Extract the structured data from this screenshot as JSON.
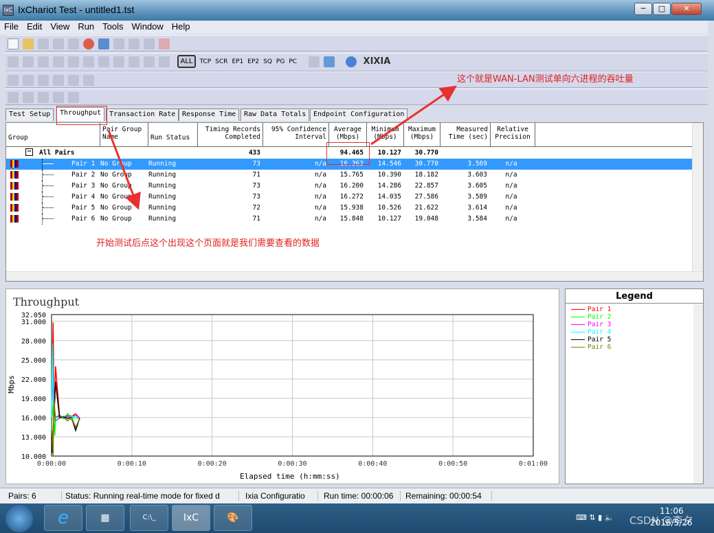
{
  "window": {
    "title": "IxChariot Test - untitled1.tst",
    "app_icon": "IxC",
    "min": "─",
    "max": "□",
    "close": "✕"
  },
  "menu": [
    "File",
    "Edit",
    "View",
    "Run",
    "Tools",
    "Window",
    "Help"
  ],
  "protocol_filters": [
    "ALL",
    "TCP",
    "SCR",
    "EP1",
    "EP2",
    "SQ",
    "PG",
    "PC"
  ],
  "brand": "XIXIA",
  "tabs": [
    "Test Setup",
    "Throughput",
    "Transaction Rate",
    "Response Time",
    "Raw Data Totals",
    "Endpoint Configuration"
  ],
  "active_tab": "Throughput",
  "table": {
    "headers": [
      "Group",
      "Pair Group\nName",
      "Run Status",
      "Timing Records\nCompleted",
      "95% Confidence\nInterval",
      "Average\n(Mbps)",
      "Minimum\n(Mbps)",
      "Maximum\n(Mbps)",
      "Measured\nTime (sec)",
      "Relative\nPrecision"
    ],
    "summary": {
      "label": "All Pairs",
      "records": "433",
      "average": "94.465",
      "minimum": "10.127",
      "maximum": "30.770"
    },
    "rows": [
      {
        "pair": "Pair 1",
        "group": "No Group",
        "status": "Running",
        "records": "73",
        "ci": "n/a",
        "avg": "16.363",
        "min": "14.546",
        "max": "30.770",
        "time": "3.569",
        "prec": "n/a"
      },
      {
        "pair": "Pair 2",
        "group": "No Group",
        "status": "Running",
        "records": "71",
        "ci": "n/a",
        "avg": "15.765",
        "min": "10.390",
        "max": "18.182",
        "time": "3.603",
        "prec": "n/a"
      },
      {
        "pair": "Pair 3",
        "group": "No Group",
        "status": "Running",
        "records": "73",
        "ci": "n/a",
        "avg": "16.200",
        "min": "14.286",
        "max": "22.857",
        "time": "3.605",
        "prec": "n/a"
      },
      {
        "pair": "Pair 4",
        "group": "No Group",
        "status": "Running",
        "records": "73",
        "ci": "n/a",
        "avg": "16.272",
        "min": "14.035",
        "max": "27.586",
        "time": "3.589",
        "prec": "n/a"
      },
      {
        "pair": "Pair 5",
        "group": "No Group",
        "status": "Running",
        "records": "72",
        "ci": "n/a",
        "avg": "15.938",
        "min": "10.526",
        "max": "21.622",
        "time": "3.614",
        "prec": "n/a"
      },
      {
        "pair": "Pair 6",
        "group": "No Group",
        "status": "Running",
        "records": "71",
        "ci": "n/a",
        "avg": "15.848",
        "min": "10.127",
        "max": "19.048",
        "time": "3.584",
        "prec": "n/a"
      }
    ]
  },
  "chart_data": {
    "type": "line",
    "title": "Throughput",
    "xlabel": "Elapsed time (h:mm:ss)",
    "ylabel": "Mbps",
    "ylim": [
      10,
      32.05
    ],
    "xlim": [
      0,
      60
    ],
    "yticks": [
      "32.050",
      "31.000",
      "28.000",
      "25.000",
      "22.000",
      "19.000",
      "16.000",
      "13.000",
      "10.000"
    ],
    "xticks": [
      "0:00:00",
      "0:00:10",
      "0:00:20",
      "0:00:30",
      "0:00:40",
      "0:00:50",
      "0:01:00"
    ],
    "grid": true,
    "legend": "right",
    "series": [
      {
        "name": "Pair 1",
        "color": "#ff0000",
        "x": [
          0,
          0.2,
          0.3,
          0.5,
          1,
          1.5,
          2,
          2.5,
          3,
          3.5
        ],
        "y": [
          16,
          30.8,
          16,
          24,
          16.2,
          16.1,
          16.4,
          16.2,
          16.6,
          15.9
        ]
      },
      {
        "name": "Pair 2",
        "color": "#00ff00",
        "x": [
          0,
          0.2,
          0.4,
          0.5,
          1,
          1.5,
          2,
          2.5,
          3,
          3.5
        ],
        "y": [
          15,
          18,
          13.2,
          16,
          16.4,
          15.8,
          16.6,
          15.6,
          16.5,
          15.5
        ]
      },
      {
        "name": "Pair 3",
        "color": "#ff00ff",
        "x": [
          0,
          0.2,
          0.3,
          0.5,
          1,
          1.5,
          2,
          2.5,
          3,
          3.5
        ],
        "y": [
          17,
          22.8,
          18,
          16,
          16.3,
          16,
          16.2,
          16.1,
          16.4,
          16
        ]
      },
      {
        "name": "Pair 4",
        "color": "#00ffff",
        "x": [
          0,
          0.1,
          0.3,
          0.5,
          1,
          1.5,
          2,
          2.5,
          3,
          3.5
        ],
        "y": [
          14,
          27.5,
          15,
          16,
          16,
          16.2,
          15.8,
          16.3,
          16,
          15.8
        ]
      },
      {
        "name": "Pair 5",
        "color": "#000000",
        "x": [
          0,
          0.1,
          0.3,
          0.5,
          1,
          1.5,
          2,
          2.5,
          3,
          3.5
        ],
        "y": [
          13,
          10.5,
          16,
          21.6,
          16,
          16.1,
          15.9,
          16,
          14,
          15.9
        ]
      },
      {
        "name": "Pair 6",
        "color": "#808000",
        "x": [
          0,
          0.2,
          0.3,
          0.5,
          1,
          1.5,
          2,
          2.5,
          3,
          3.5
        ],
        "y": [
          16,
          10.1,
          19,
          15.5,
          15.9,
          16,
          15.5,
          16,
          14.5,
          15.8
        ]
      }
    ]
  },
  "legend_title": "Legend",
  "status": {
    "pairs": "Pairs: 6",
    "status": "Status: Running real-time mode for fixed d",
    "config": "Ixia Configuratio",
    "runtime": "Run time: 00:00:06",
    "remaining": "Remaining: 00:00:54"
  },
  "taskbar": {
    "clock_time": "11:06",
    "clock_date": "2016/5/26",
    "watermark": "CSDN @李夕"
  },
  "annotations": {
    "top": "这个就是WAN-LAN测试单向六进程的吞吐量",
    "middle": "开始测试后点这个出现这个页面就是我们需要查看的数据",
    "color": "#e02020"
  }
}
